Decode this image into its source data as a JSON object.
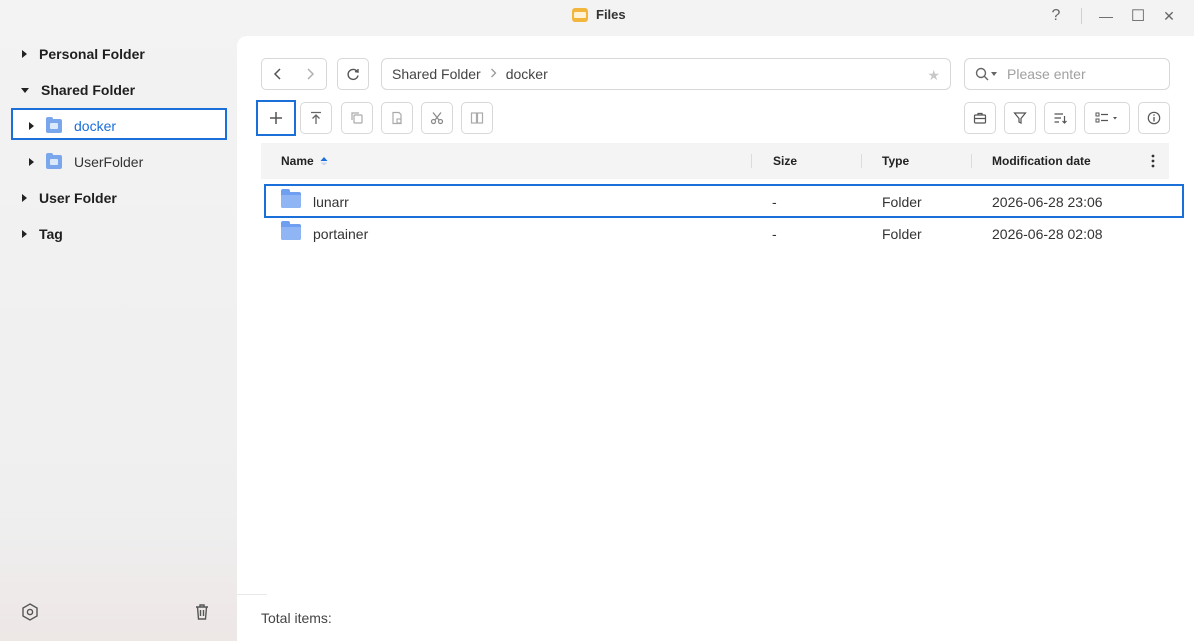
{
  "window": {
    "title": "Files",
    "help_icon": "?",
    "minimize_icon": "—",
    "maximize_icon": "☐",
    "close_icon": "✕"
  },
  "sidebar": {
    "items": [
      {
        "label": "Personal Folder"
      },
      {
        "label": "Shared Folder"
      },
      {
        "label": "docker"
      },
      {
        "label": "UserFolder"
      },
      {
        "label": "User Folder"
      },
      {
        "label": "Tag"
      }
    ]
  },
  "toolbar": {
    "breadcrumb": [
      "Shared Folder",
      "docker"
    ],
    "search_placeholder": "Please enter"
  },
  "table": {
    "columns": [
      "Name",
      "Size",
      "Type",
      "Modification date"
    ],
    "rows": [
      {
        "name": "lunarr",
        "size": "-",
        "type": "Folder",
        "modified": "2026-06-28 23:06"
      },
      {
        "name": "portainer",
        "size": "-",
        "type": "Folder",
        "modified": "2026-06-28 02:08"
      }
    ]
  },
  "footer": {
    "total_label": "Total items:"
  },
  "colors": {
    "accent": "#1a6fd9",
    "folder": "#6f9ff0",
    "app_icon": "#f3b63d"
  }
}
